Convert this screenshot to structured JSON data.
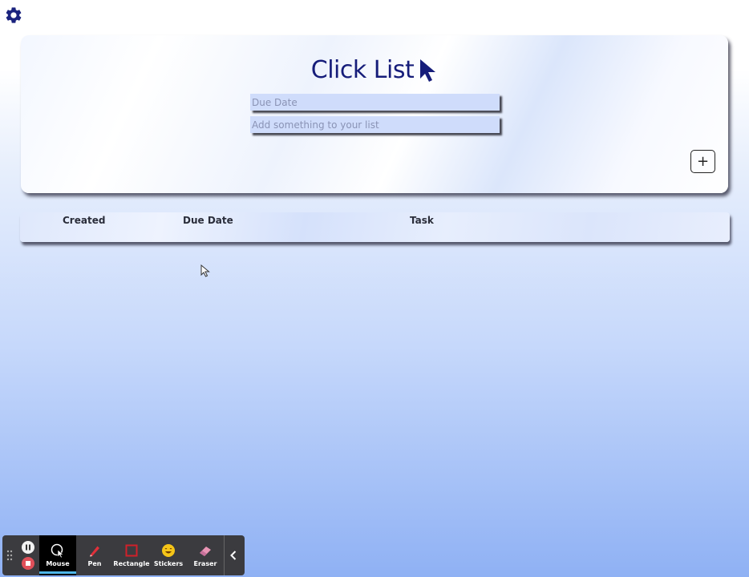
{
  "app": {
    "title": "Click List"
  },
  "form": {
    "due_date_placeholder": "Due Date",
    "task_placeholder": "Add something to your list",
    "add_label": "+"
  },
  "table": {
    "columns": [
      "Created",
      "Due Date",
      "Task"
    ]
  },
  "toolbar": {
    "tools": [
      {
        "label": "Mouse",
        "icon": "mouse-icon",
        "active": true
      },
      {
        "label": "Pen",
        "icon": "pen-icon",
        "active": false
      },
      {
        "label": "Rectangle",
        "icon": "rectangle-icon",
        "active": false
      },
      {
        "label": "Stickers",
        "icon": "sticker-icon",
        "active": false
      },
      {
        "label": "Eraser",
        "icon": "eraser-icon",
        "active": false
      }
    ]
  },
  "colors": {
    "accent": "#161d7a",
    "input_bg": "#cfdcfb",
    "toolbar_bg": "#3b3b3f",
    "active_underline": "#4db6e8",
    "stop_red": "#e0505a"
  }
}
